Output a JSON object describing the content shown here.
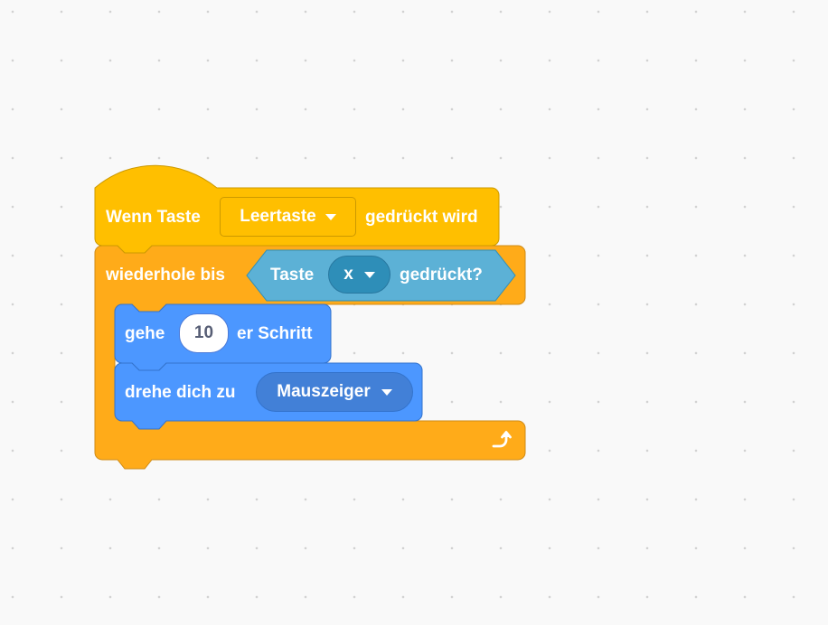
{
  "colors": {
    "events": "#ffbf00",
    "control": "#ffab19",
    "sensing": "#5cb1d6",
    "motion": "#4c97ff",
    "workspace": "#f9f9f9"
  },
  "blocks": {
    "when_key": {
      "label_1": "Wenn Taste",
      "key_value": "Leertaste",
      "label_2": "gedrückt wird"
    },
    "repeat_until": {
      "label": "wiederhole bis",
      "condition": {
        "label_1": "Taste",
        "key_value": "x",
        "label_2": "gedrückt?"
      },
      "loop_icon": "loop-arrow-icon"
    },
    "move_steps": {
      "label_1": "gehe",
      "value": "10",
      "label_2": "er Schritt"
    },
    "point_towards": {
      "label": "drehe dich zu",
      "target_value": "Mauszeiger"
    }
  }
}
